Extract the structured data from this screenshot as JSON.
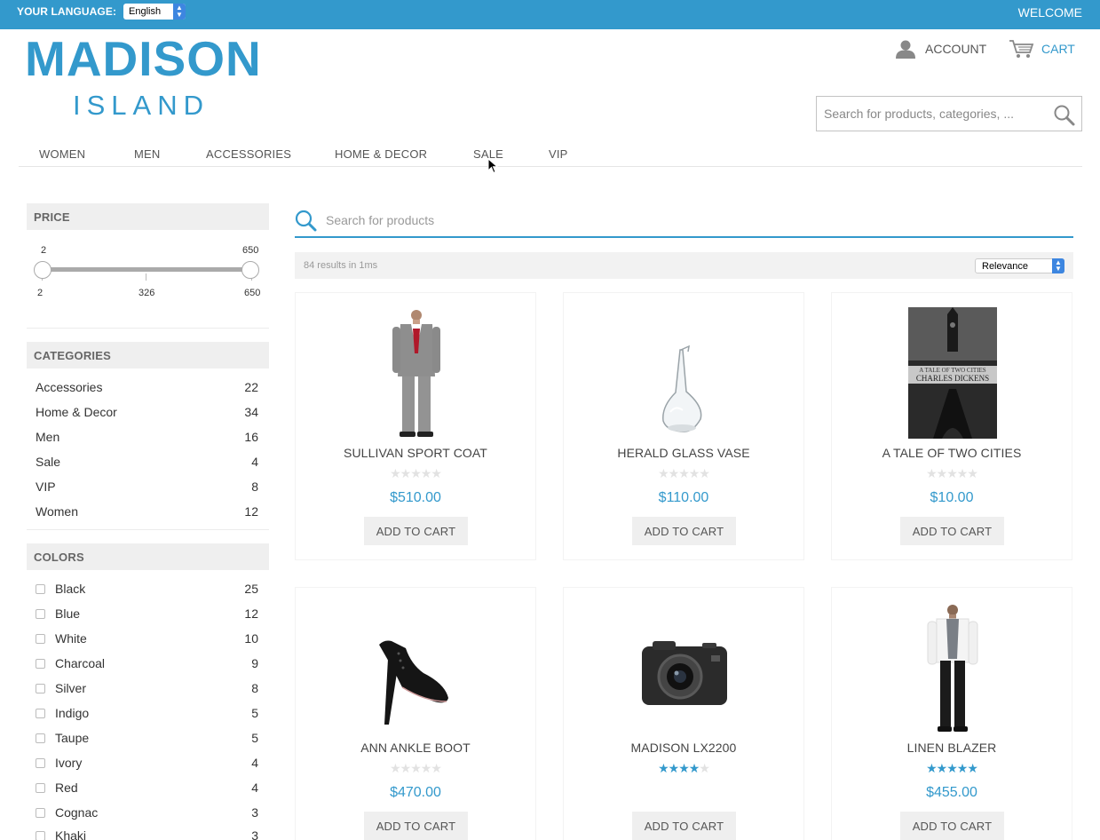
{
  "topbar": {
    "language_label": "YOUR LANGUAGE:",
    "language_value": "English",
    "welcome": "WELCOME"
  },
  "logo": {
    "main": "MADISON",
    "sub": "ISLAND"
  },
  "header": {
    "account_label": "ACCOUNT",
    "cart_label": "CART",
    "search_placeholder": "Search for products, categories, ..."
  },
  "nav": [
    "WOMEN",
    "MEN",
    "ACCESSORIES",
    "HOME & DECOR",
    "SALE",
    "VIP"
  ],
  "price_filter": {
    "title": "PRICE",
    "selected_min": "2",
    "selected_max": "650",
    "scale_min": "2",
    "scale_mid": "326",
    "scale_max": "650"
  },
  "categories": {
    "title": "CATEGORIES",
    "items": [
      {
        "name": "Accessories",
        "count": "22"
      },
      {
        "name": "Home & Decor",
        "count": "34"
      },
      {
        "name": "Men",
        "count": "16"
      },
      {
        "name": "Sale",
        "count": "4"
      },
      {
        "name": "VIP",
        "count": "8"
      },
      {
        "name": "Women",
        "count": "12"
      }
    ]
  },
  "colors": {
    "title": "COLORS",
    "items": [
      {
        "name": "Black",
        "count": "25"
      },
      {
        "name": "Blue",
        "count": "12"
      },
      {
        "name": "White",
        "count": "10"
      },
      {
        "name": "Charcoal",
        "count": "9"
      },
      {
        "name": "Silver",
        "count": "8"
      },
      {
        "name": "Indigo",
        "count": "5"
      },
      {
        "name": "Taupe",
        "count": "5"
      },
      {
        "name": "Ivory",
        "count": "4"
      },
      {
        "name": "Red",
        "count": "4"
      },
      {
        "name": "Cognac",
        "count": "3"
      },
      {
        "name": "Khaki",
        "count": "3"
      }
    ]
  },
  "main": {
    "search_placeholder": "Search for products",
    "stats": "84 results in 1ms",
    "sort_value": "Relevance",
    "add_to_cart_label": "ADD TO CART"
  },
  "products": [
    {
      "name": "SULLIVAN SPORT COAT",
      "price": "$510.00",
      "rating": 0,
      "image": "suit-image"
    },
    {
      "name": "HERALD GLASS VASE",
      "price": "$110.00",
      "rating": 0,
      "image": "vase-image"
    },
    {
      "name": "A TALE OF TWO CITIES",
      "price": "$10.00",
      "rating": 0,
      "image": "book-image"
    },
    {
      "name": "ANN ANKLE BOOT",
      "price": "$470.00",
      "rating": 0,
      "image": "boot-image"
    },
    {
      "name": "MADISON LX2200",
      "price": "",
      "rating": 4,
      "image": "camera-image"
    },
    {
      "name": "LINEN BLAZER",
      "price": "$455.00",
      "rating": 5,
      "image": "blazer-image"
    }
  ],
  "book_cover": {
    "title": "A TALE OF TWO CITIES",
    "author": "CHARLES DICKENS"
  },
  "colors_theme": {
    "accent": "#3399cc",
    "panel": "#efefef",
    "select_blue": "#3d86e0"
  }
}
